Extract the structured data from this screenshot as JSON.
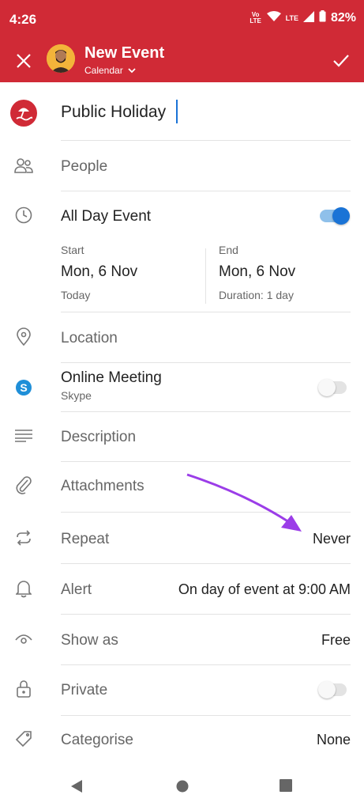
{
  "status": {
    "time": "4:26",
    "network": "Vo LTE",
    "lte": "LTE",
    "battery": "82%"
  },
  "header": {
    "title": "New Event",
    "calendar_label": "Calendar"
  },
  "event": {
    "title": "Public Holiday"
  },
  "people": {
    "label": "People"
  },
  "all_day": {
    "label": "All Day Event",
    "on": true
  },
  "start": {
    "caption": "Start",
    "date": "Mon, 6 Nov",
    "note": "Today"
  },
  "end": {
    "caption": "End",
    "date": "Mon, 6 Nov",
    "note": "Duration: 1 day"
  },
  "location": {
    "label": "Location"
  },
  "online_meeting": {
    "label": "Online Meeting",
    "provider": "Skype",
    "on": false
  },
  "description": {
    "label": "Description"
  },
  "attachments": {
    "label": "Attachments"
  },
  "repeat": {
    "label": "Repeat",
    "value": "Never"
  },
  "alert": {
    "label": "Alert",
    "value": "On day of event at 9:00 AM"
  },
  "show_as": {
    "label": "Show as",
    "value": "Free"
  },
  "private": {
    "label": "Private",
    "on": false
  },
  "categorise": {
    "label": "Categorise",
    "value": "None"
  },
  "colors": {
    "brand": "#d02a36",
    "accent": "#1a73d6",
    "annotation_arrow": "#9b3de8"
  }
}
